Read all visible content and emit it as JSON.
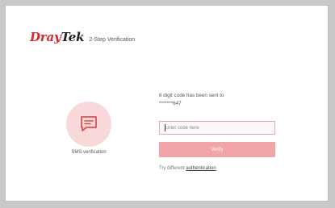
{
  "header": {
    "logo_part1": "Dray",
    "logo_part2": "Tek",
    "page_title": "2-Step Verification"
  },
  "method": {
    "icon": "sms-chat-icon",
    "label": "SMS verification"
  },
  "form": {
    "sent_line1": "6 digit code has been sent to",
    "sent_line2": "*******647",
    "code_placeholder": "Enter code here",
    "code_value": "",
    "verify_label": "Verify",
    "alt_prefix": "Try different",
    "alt_link": "authentication"
  },
  "colors": {
    "brand_red": "#d8262d",
    "button_pink": "#f2a4a8",
    "circle_pink": "#f8d8d8",
    "icon_red": "#d9534f"
  }
}
